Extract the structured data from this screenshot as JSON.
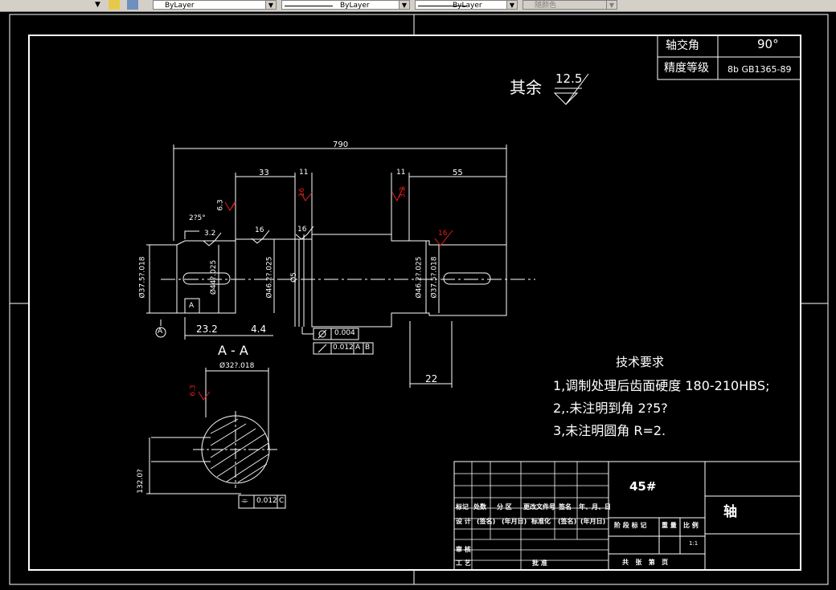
{
  "toolbar": {
    "layer_combo": "ByLayer",
    "linetype_combo": "ByLayer",
    "lineweight_combo": "ByLayer",
    "color_combo": "随颜色"
  },
  "drawing": {
    "spec_table": {
      "row1_label": "轴交角",
      "row1_value": "90°",
      "row2_label": "精度等级",
      "row2_value": "8b GB1365-89"
    },
    "roughness_other": "其余",
    "roughness_other_value": "12.5",
    "dims": {
      "overall_length": "790",
      "d33": "33",
      "d11a": "11",
      "d11b": "11",
      "d55": "55",
      "angle": "2?5°",
      "r63": "6.3",
      "r32a": "3.2",
      "r16a": "16",
      "r16b": "16",
      "r16c": "16",
      "r32b": "3.2",
      "r16d": "16",
      "dia1": "Ø37.5?.018",
      "dia2": "Ø44?.025",
      "dia3": "Ø46.2?.025",
      "dia4": "Ø5",
      "dia5": "Ø46.2?.025",
      "dia6": "Ø37.5?.018",
      "d232": "23.2",
      "d44": "4.4",
      "d22": "22",
      "datum_a": "A",
      "datum_a2": "A",
      "tol1_value": "0.004",
      "tol2_value": "0.012",
      "tol2_ref1": "A",
      "tol2_ref2": "B",
      "section_title": "A - A",
      "sec_dia": "Ø32?.018",
      "sec_r63": "6.3",
      "sec_vert": "132.0?",
      "sec_tol_value": "0.012",
      "sec_tol_ref": "C"
    },
    "tech": {
      "title": "技术要求",
      "line1": "1,调制处理后齿面硬度 180-210HBS;",
      "line2": "2,.未注明到角 2?5?",
      "line3": "3,未注明圆角 R=2."
    },
    "title_block": {
      "material": "45#",
      "part_name": "轴",
      "c_mark": "标记",
      "c_count": "处数",
      "c_zone": "分 区",
      "c_docno": "更改文件号",
      "c_sign": "签名",
      "c_date": "年、月、日",
      "c_design": "设 计",
      "c_sign2": "(签名)",
      "c_date2": "(年月日)",
      "c_std": "标准化",
      "c_sign3": "(签名)",
      "c_date3": "(年月日)",
      "c_stage": "阶 段 标 记",
      "c_weight": "重 量",
      "c_scale": "比 例",
      "c_scale_val": "1:1",
      "c_review": "审 核",
      "c_process": "工 艺",
      "c_approve": "批 准",
      "c_sheets": "共   张   第   页"
    }
  }
}
